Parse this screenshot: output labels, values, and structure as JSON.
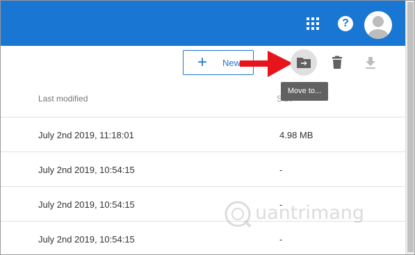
{
  "toolbar": {
    "new_label": "New",
    "tooltip": "Move to..."
  },
  "columns": {
    "modified": "Last modified",
    "size": "Size"
  },
  "rows": [
    {
      "modified": "July 2nd 2019, 11:18:01",
      "size": "4.98 MB"
    },
    {
      "modified": "July 2nd 2019, 10:54:15",
      "size": "-"
    },
    {
      "modified": "July 2nd 2019, 10:54:15",
      "size": "-"
    },
    {
      "modified": "July 2nd 2019, 10:54:15",
      "size": "-"
    }
  ],
  "watermark": {
    "text": "uantrimang"
  },
  "colors": {
    "header": "#1976d2",
    "arrow": "#e8141b",
    "tooltip": "#616161"
  },
  "icons": {
    "apps": "apps-grid-icon",
    "help": "help-icon",
    "avatar": "account-avatar-icon",
    "move": "move-to-folder-icon",
    "delete": "trash-icon",
    "download": "download-icon"
  }
}
